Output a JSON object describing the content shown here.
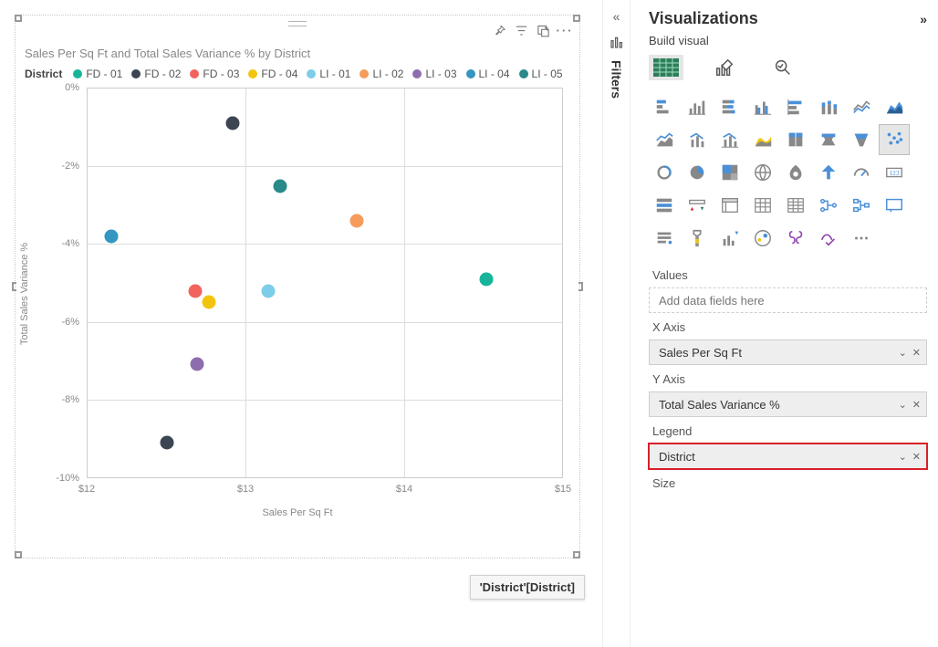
{
  "chart": {
    "title": "Sales Per Sq Ft and Total Sales Variance % by District",
    "x_axis_label": "Sales Per Sq Ft",
    "y_axis_label": "Total Sales Variance %",
    "legend_title": "District",
    "x_ticks": [
      "$12",
      "$13",
      "$14",
      "$15"
    ],
    "y_ticks": [
      "0%",
      "-2%",
      "-4%",
      "-6%",
      "-8%",
      "-10%"
    ],
    "series": [
      {
        "name": "FD - 01",
        "color": "#18b39b"
      },
      {
        "name": "FD - 02",
        "color": "#3b4652"
      },
      {
        "name": "FD - 03",
        "color": "#f2635f"
      },
      {
        "name": "FD - 04",
        "color": "#f2c40f"
      },
      {
        "name": "LI - 01",
        "color": "#7dcde8"
      },
      {
        "name": "LI - 02",
        "color": "#f59c5a"
      },
      {
        "name": "LI - 03",
        "color": "#8e6dae"
      },
      {
        "name": "LI - 04",
        "color": "#3397c1"
      },
      {
        "name": "LI - 05",
        "color": "#2a8a8a"
      }
    ]
  },
  "chart_data": {
    "type": "scatter",
    "title": "Sales Per Sq Ft and Total Sales Variance % by District",
    "xlabel": "Sales Per Sq Ft",
    "ylabel": "Total Sales Variance %",
    "xlim": [
      12,
      15
    ],
    "ylim": [
      -10,
      0
    ],
    "series": [
      {
        "name": "FD - 01",
        "color": "#18b39b",
        "x": [
          14.52
        ],
        "y": [
          -4.9
        ]
      },
      {
        "name": "FD - 02",
        "color": "#3b4652",
        "x": [
          12.92,
          12.5
        ],
        "y": [
          -0.9,
          -9.1
        ]
      },
      {
        "name": "FD - 03",
        "color": "#f2635f",
        "x": [
          12.68
        ],
        "y": [
          -5.2
        ]
      },
      {
        "name": "FD - 04",
        "color": "#f2c40f",
        "x": [
          12.77
        ],
        "y": [
          -5.5
        ]
      },
      {
        "name": "LI - 01",
        "color": "#7dcde8",
        "x": [
          13.14
        ],
        "y": [
          -5.2
        ]
      },
      {
        "name": "LI - 02",
        "color": "#f59c5a",
        "x": [
          13.7
        ],
        "y": [
          -3.4
        ]
      },
      {
        "name": "LI - 03",
        "color": "#8e6dae",
        "x": [
          12.69
        ],
        "y": [
          -7.1
        ]
      },
      {
        "name": "LI - 04",
        "color": "#3397c1",
        "x": [
          12.15
        ],
        "y": [
          -3.8
        ]
      },
      {
        "name": "LI - 05",
        "color": "#2a8a8a",
        "x": [
          13.22
        ],
        "y": [
          -2.5
        ]
      }
    ]
  },
  "filters": {
    "label": "Filters"
  },
  "viz_panel": {
    "title": "Visualizations",
    "subhead": "Build visual",
    "wells": {
      "values_label": "Values",
      "values_placeholder": "Add data fields here",
      "xaxis_label": "X Axis",
      "xaxis_field": "Sales Per Sq Ft",
      "yaxis_label": "Y Axis",
      "yaxis_field": "Total Sales Variance %",
      "legend_label": "Legend",
      "legend_field": "District",
      "size_label": "Size"
    }
  },
  "tooltip_tag": "'District'[District]"
}
